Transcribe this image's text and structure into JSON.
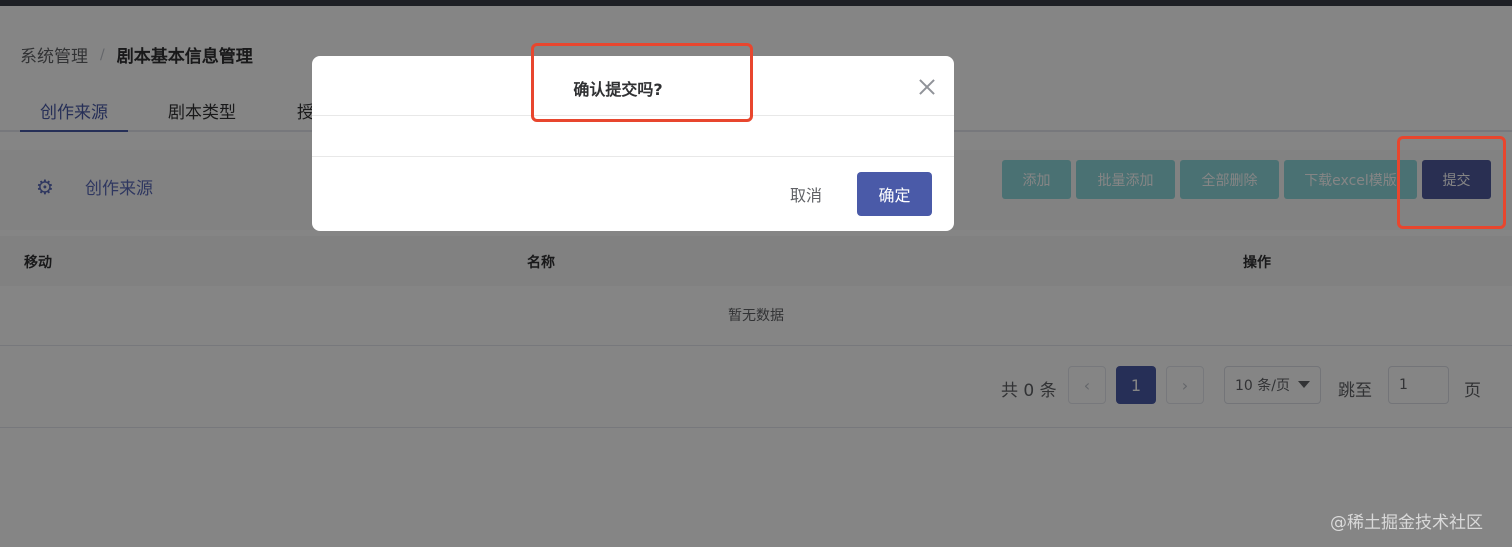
{
  "breadcrumb": {
    "root": "系统管理",
    "separator": "/",
    "current": "剧本基本信息管理"
  },
  "tabs": [
    {
      "label": "创作来源",
      "active": true
    },
    {
      "label": "剧本类型",
      "active": false
    },
    {
      "label": "授",
      "active": false
    }
  ],
  "section": {
    "icon": "gear-icon",
    "title": "创作来源"
  },
  "toolbar": {
    "add_label": "添加",
    "batch_add_label": "批量添加",
    "delete_all_label": "全部删除",
    "download_template_label": "下载excel模版",
    "submit_label": "提交"
  },
  "table": {
    "columns": [
      "移动",
      "名称",
      "操作"
    ],
    "empty_text": "暂无数据"
  },
  "pagination": {
    "total_text": "共 0 条",
    "prev_icon": "chevron-left-icon",
    "current_page": "1",
    "next_icon": "chevron-right-icon",
    "page_size": "10 条/页",
    "jump_label": "跳至",
    "jump_value": "1",
    "page_suffix": "页"
  },
  "dialog": {
    "title": "确认提交吗?",
    "cancel_label": "取消",
    "ok_label": "确定",
    "close_icon": "close-icon"
  },
  "watermark": "@稀土掘金技术社区",
  "colors": {
    "accent": "#4a5aa8",
    "teal_button": "#8fd8dc",
    "highlight": "#e8462e"
  }
}
